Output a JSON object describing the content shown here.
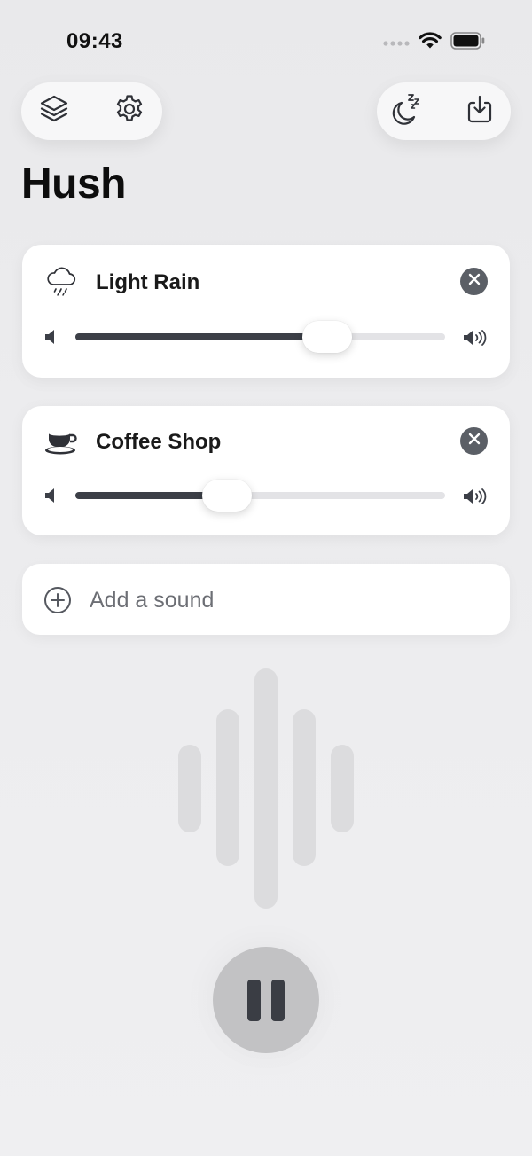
{
  "status_bar": {
    "time": "09:43",
    "icons": [
      "signal-dots-icon",
      "wifi-icon",
      "battery-icon"
    ]
  },
  "toolbar": {
    "left_buttons": [
      "layers-icon",
      "gear-icon"
    ],
    "right_buttons": [
      "sleep-timer-icon",
      "download-icon"
    ]
  },
  "app": {
    "title": "Hush"
  },
  "sounds": [
    {
      "label": "Light Rain",
      "icon": "rain-cloud-icon",
      "volume_percent": 68
    },
    {
      "label": "Coffee Shop",
      "icon": "coffee-cup-icon",
      "volume_percent": 41
    }
  ],
  "add_sound": {
    "label": "Add a sound",
    "icon": "plus-circle-icon"
  },
  "player": {
    "state": "playing",
    "control_icon": "pause-icon"
  },
  "colors": {
    "background": "#ececee",
    "card": "#ffffff",
    "slider_fill": "#3c3f47",
    "slider_track": "#e3e3e6",
    "remove_button": "#5b5f66",
    "visualizer_bar": "#dcdcde",
    "pause_button": "#c2c2c4"
  }
}
